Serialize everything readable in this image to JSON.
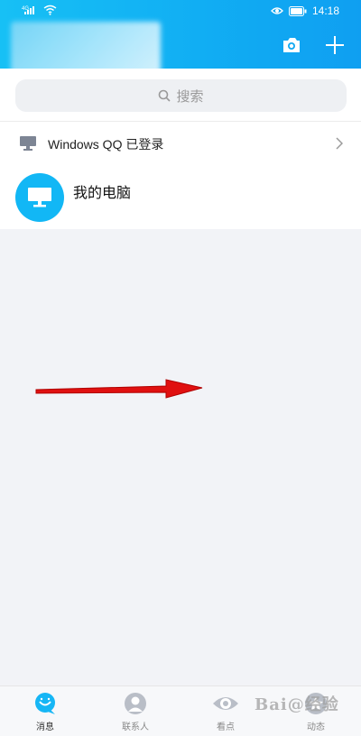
{
  "status_bar": {
    "network": "4G",
    "time": "14:18"
  },
  "search": {
    "placeholder": "搜索"
  },
  "pc_login_row": {
    "label": "Windows QQ 已登录"
  },
  "my_pc": {
    "label": "我的电脑"
  },
  "tabs": [
    {
      "label": "消息",
      "icon": "chat-bubble-icon",
      "active": true
    },
    {
      "label": "联系人",
      "icon": "person-icon",
      "active": false
    },
    {
      "label": "看点",
      "icon": "eye-icon",
      "active": false
    },
    {
      "label": "动态",
      "icon": "star-icon",
      "active": false
    }
  ],
  "watermark": "Bai@经验",
  "colors": {
    "header_start": "#17c0f5",
    "header_end": "#0f9ff1",
    "accent": "#12b7f5",
    "arrow": "#e01010"
  }
}
